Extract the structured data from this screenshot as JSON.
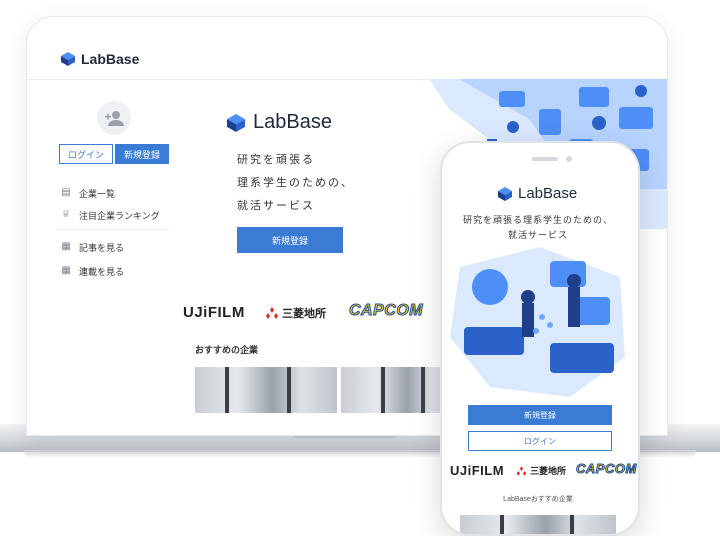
{
  "laptop": {
    "header": {
      "brand": "LabBase"
    },
    "sidebar": {
      "login_label": "ログイン",
      "signup_label": "新規登録",
      "items": [
        {
          "label": "企業一覧",
          "icon": "building-icon"
        },
        {
          "label": "注目企業ランキング",
          "icon": "crown-icon"
        },
        {
          "label": "記事を見る",
          "icon": "document-icon"
        },
        {
          "label": "連載を見る",
          "icon": "document-icon"
        }
      ]
    },
    "hero": {
      "brand": "LabBase",
      "tagline_1": "研究を頑張る",
      "tagline_2": "理系学生のための、",
      "tagline_3": "就活サービス",
      "signup_label": "新規登録"
    },
    "clients": [
      "UJiFILM",
      "三菱地所",
      "CAPCOM"
    ],
    "recommended_title": "おすすめの企業"
  },
  "phone": {
    "brand": "LabBase",
    "tagline_1": "研究を頑張る理系学生のための、",
    "tagline_2": "就活サービス",
    "signup_label": "新規登録",
    "login_label": "ログイン",
    "clients": [
      "UJiFILM",
      "三菱地所",
      "CAPCOM"
    ],
    "recommended_title": "LabBaseおすすめ企業"
  },
  "colors": {
    "accent": "#3a7bd5",
    "brand_dark": "#1f2a36",
    "illustration": "#4d8ff7"
  }
}
